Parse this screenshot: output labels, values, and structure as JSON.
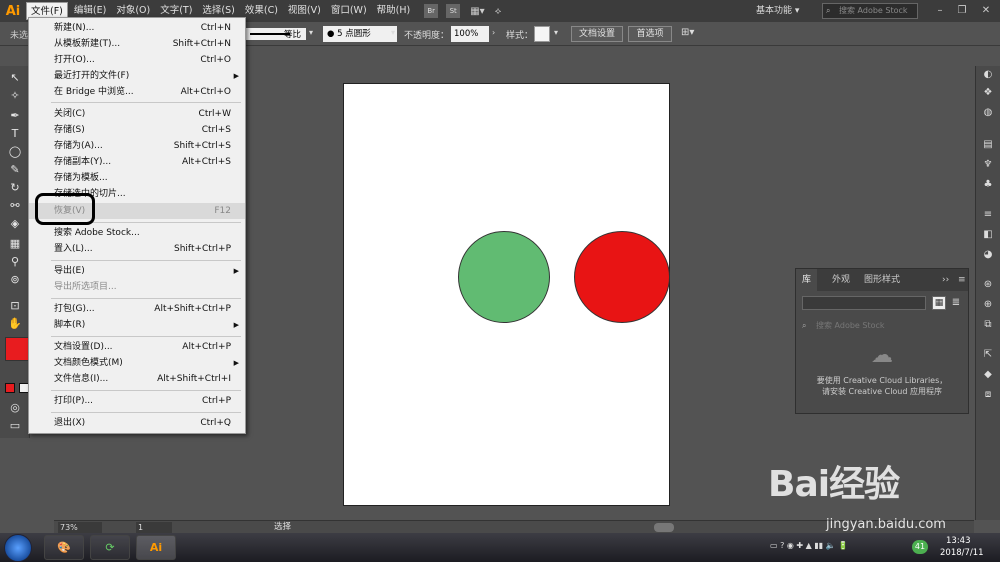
{
  "app": {
    "logo": "Ai"
  },
  "menubar": {
    "items": [
      "文件(F)",
      "编辑(E)",
      "对象(O)",
      "文字(T)",
      "选择(S)",
      "效果(C)",
      "视图(V)",
      "窗口(W)",
      "帮助(H)"
    ],
    "bridge": "Br",
    "stock": "St",
    "workspace": "基本功能",
    "search_placeholder": "搜索 Adobe Stock"
  },
  "controlbar": {
    "selection_label": "未选",
    "stroke_profile": "等比",
    "brush": "5 点圆形",
    "opacity_label": "不透明度：",
    "opacity_value": "100%",
    "style_label": "样式：",
    "doc_setup_button": "文档设置",
    "preferences_button": "首选项"
  },
  "file_menu": {
    "items": [
      {
        "label": "新建(N)...",
        "shortcut": "Ctrl+N"
      },
      {
        "label": "从模板新建(T)...",
        "shortcut": "Shift+Ctrl+N"
      },
      {
        "label": "打开(O)...",
        "shortcut": "Ctrl+O"
      },
      {
        "label": "最近打开的文件(F)",
        "shortcut": ""
      },
      {
        "label": "在 Bridge 中浏览...",
        "shortcut": "Alt+Ctrl+O"
      },
      {
        "label": "关闭(C)",
        "shortcut": "Ctrl+W"
      },
      {
        "label": "存储(S)",
        "shortcut": "Ctrl+S"
      },
      {
        "label": "存储为(A)...",
        "shortcut": "Shift+Ctrl+S"
      },
      {
        "label": "存储副本(Y)...",
        "shortcut": "Alt+Ctrl+S"
      },
      {
        "label": "存储为模板...",
        "shortcut": ""
      },
      {
        "label": "存储选中的切片...",
        "shortcut": ""
      },
      {
        "label": "恢复(V)",
        "shortcut": "F12"
      },
      {
        "label": "搜索 Adobe Stock...",
        "shortcut": ""
      },
      {
        "label": "置入(L)...",
        "shortcut": "Shift+Ctrl+P"
      },
      {
        "label": "导出(E)",
        "shortcut": ""
      },
      {
        "label": "导出所选项目...",
        "shortcut": ""
      },
      {
        "label": "打包(G)...",
        "shortcut": "Alt+Shift+Ctrl+P"
      },
      {
        "label": "脚本(R)",
        "shortcut": ""
      },
      {
        "label": "文档设置(D)...",
        "shortcut": "Alt+Ctrl+P"
      },
      {
        "label": "文档颜色模式(M)",
        "shortcut": ""
      },
      {
        "label": "文件信息(I)...",
        "shortcut": "Alt+Shift+Ctrl+I"
      },
      {
        "label": "打印(P)...",
        "shortcut": "Ctrl+P"
      },
      {
        "label": "退出(X)",
        "shortcut": "Ctrl+Q"
      }
    ]
  },
  "colors": {
    "fill": "#e81c1f",
    "green_circle": "#61bb72",
    "red_circle": "#e81414"
  },
  "library_panel": {
    "tabs": [
      "库",
      "外观",
      "图形样式"
    ],
    "dropdown": "",
    "search_placeholder": "搜索 Adobe Stock",
    "message_line1": "要使用 Creative Cloud Libraries，",
    "message_line2": "请安装 Creative Cloud 应用程序"
  },
  "statusbar": {
    "zoom": "73%",
    "page": "1",
    "tool": "选择"
  },
  "taskbar": {
    "ai_app": "Ai",
    "badge": "41",
    "time": "13:43",
    "date": "2018/7/11"
  },
  "watermark": {
    "logo": "Bai经验",
    "url": "jingyan.baidu.com"
  }
}
